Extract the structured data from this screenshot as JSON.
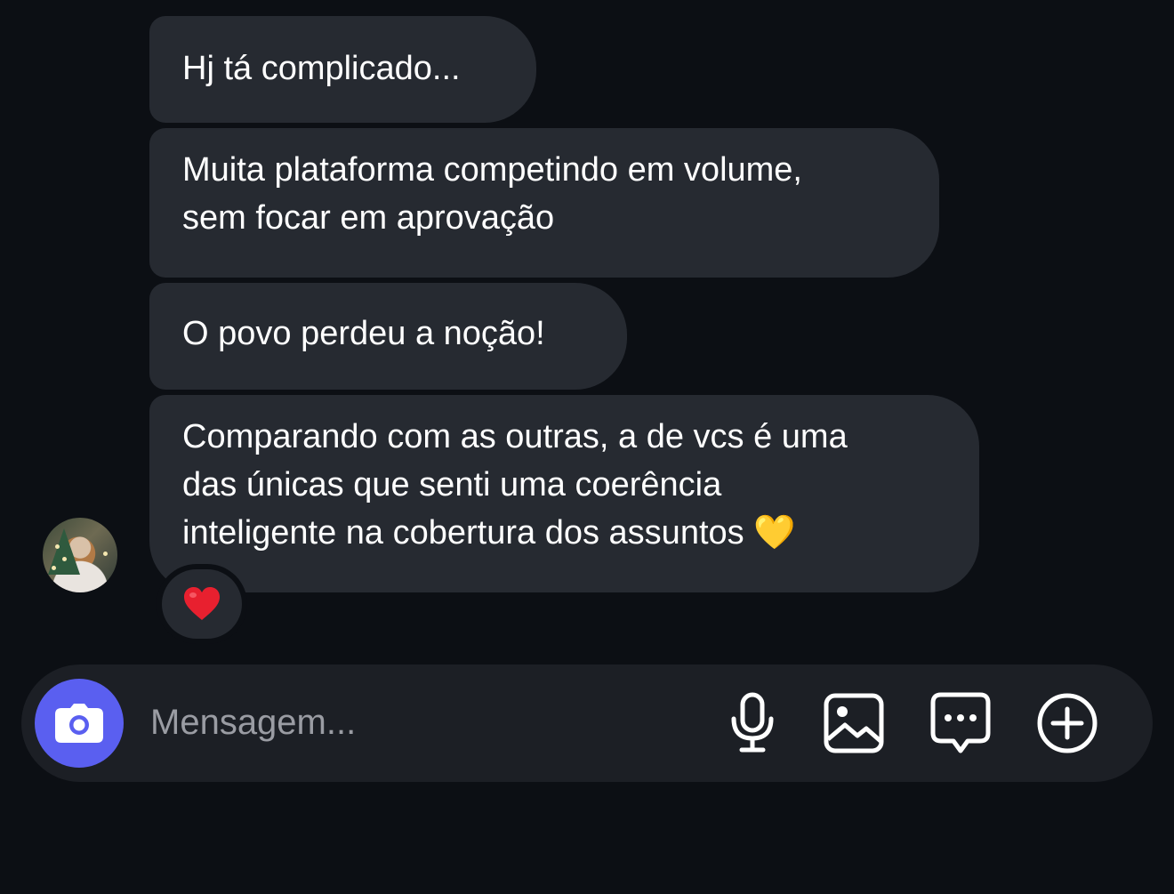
{
  "messages": [
    {
      "text": "Hj tá complicado..."
    },
    {
      "text": "Muita plataforma competindo em volume,\nsem focar em aprovação"
    },
    {
      "text": "O povo perdeu a noção!"
    },
    {
      "text": "Comparando com as outras, a de vcs é uma\ndas únicas que senti uma coerência\ninteligente na cobertura dos assuntos 💛"
    }
  ],
  "reaction": {
    "emoji": "❤️"
  },
  "composer": {
    "placeholder": "Mensagem..."
  },
  "icons": {
    "camera": "camera-icon",
    "mic": "microphone-icon",
    "gallery": "image-gallery-icon",
    "sticker": "sticker-chat-icon",
    "plus": "add-circle-icon"
  },
  "colors": {
    "background": "#0c0f14",
    "bubble": "#262a31",
    "composer": "#1c1f25",
    "camera_button": "#5a5ff0",
    "placeholder": "#9a9ca3"
  }
}
